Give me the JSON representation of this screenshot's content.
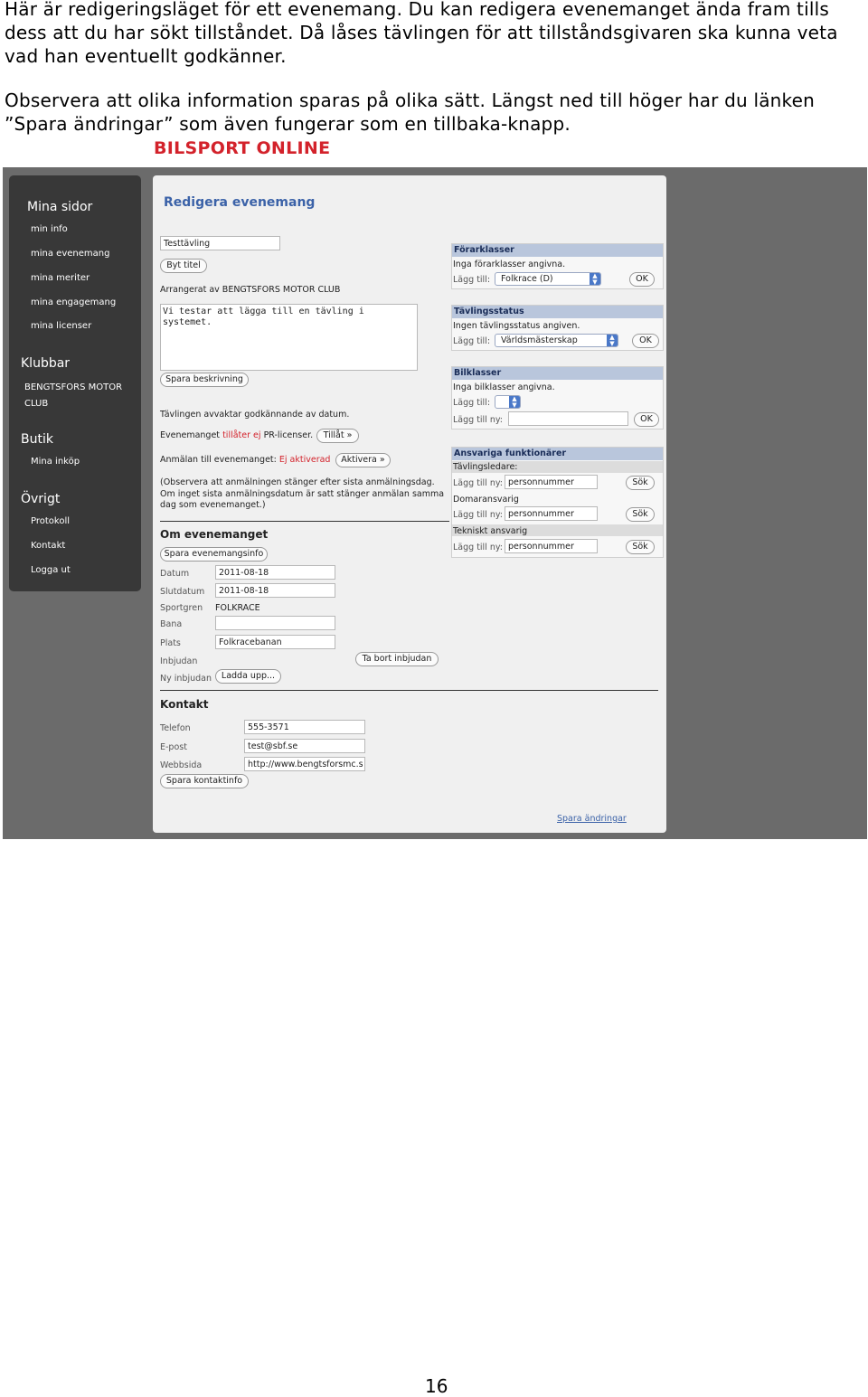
{
  "intro": {
    "p1": "Här är redigeringsläget för ett evenemang. Du kan redigera evenemanget ända fram tills dess att du har sökt tillståndet. Då låses tävlingen för att tillståndsgivaren ska kunna veta vad han eventuellt godkänner.",
    "p2": "Observera att olika information sparas på olika sätt. Längst ned till höger har du länken ”Spara ändringar” som även fungerar som en tillbaka-knapp."
  },
  "logo": "BILSPORT ONLINE",
  "sidebar": {
    "mina_sidor": "Mina sidor",
    "mina_items": [
      "min info",
      "mina evenemang",
      "mina meriter",
      "mina engagemang",
      "mina licenser"
    ],
    "klubbar": "Klubbar",
    "club": "BENGTSFORS MOTOR CLUB",
    "butik": "Butik",
    "butik_items": [
      "Mina inköp"
    ],
    "ovrigt": "Övrigt",
    "ovrigt_items": [
      "Protokoll",
      "Kontakt",
      "Logga ut"
    ]
  },
  "main": {
    "title": "Redigera evenemang",
    "event_name": "Testtävling",
    "byt_titel": "Byt titel",
    "arranger": "Arrangerat av BENGTSFORS MOTOR CLUB",
    "description": "Vi testar att lägga till en tävling i systemet.",
    "spara_beskrivning": "Spara beskrivning",
    "awaiting": "Tävlingen avvaktar godkännande av datum.",
    "event_prefix": "Evenemanget",
    "event_status": "tillåter ej",
    "event_suffix": "PR-licenser.",
    "tillat": "Tillåt »",
    "anmalan_prefix": "Anmälan till evenemanget:",
    "anmalan_status": "Ej aktiverad",
    "aktivera": "Aktivera »",
    "note": "(Observera att anmälningen stänger efter sista anmälningsdag. Om inget sista anmälningsdatum är satt stänger anmälan samma dag som evenemanget.)"
  },
  "om": {
    "title": "Om evenemanget",
    "save": "Spara evenemangsinfo",
    "datum_label": "Datum",
    "datum": "2011-08-18",
    "slutdatum_label": "Slutdatum",
    "slutdatum": "2011-08-18",
    "sportgren_label": "Sportgren",
    "sportgren": "FOLKRACE",
    "bana_label": "Bana",
    "bana": "",
    "plats_label": "Plats",
    "plats": "Folkracebanan",
    "inbjudan_label": "Inbjudan",
    "ta_bort": "Ta bort inbjudan",
    "ny_inbjudan_label": "Ny inbjudan",
    "ladda": "Ladda upp..."
  },
  "kontakt": {
    "title": "Kontakt",
    "telefon_label": "Telefon",
    "telefon": "555-3571",
    "epost_label": "E-post",
    "epost": "test@sbf.se",
    "webb_label": "Webbsida",
    "webb": "http://www.bengtsforsmc.s",
    "save": "Spara kontaktinfo"
  },
  "forarklasser": {
    "title": "Förarklasser",
    "status": "Inga förarklasser angivna.",
    "add_label": "Lägg till:",
    "selected": "Folkrace (D)",
    "ok": "OK"
  },
  "tavlingsstatus": {
    "title": "Tävlingsstatus",
    "status": "Ingen tävlingsstatus angiven.",
    "add_label": "Lägg till:",
    "selected": "Världsmästerskap",
    "ok": "OK"
  },
  "bilklasser": {
    "title": "Bilklasser",
    "status": "Inga bilklasser angivna.",
    "add_label": "Lägg till:",
    "selected": "",
    "new_label": "Lägg till ny:",
    "ok": "OK"
  },
  "ansvariga": {
    "title": "Ansvariga funktionärer",
    "roles": [
      {
        "name": "Tävlingsledare:",
        "add_label": "Lägg till ny:",
        "placeholder": "personnummer",
        "button": "Sök"
      },
      {
        "name": "Domaransvarig",
        "add_label": "Lägg till ny:",
        "placeholder": "personnummer",
        "button": "Sök"
      },
      {
        "name": "Tekniskt ansvarig",
        "add_label": "Lägg till ny:",
        "placeholder": "personnummer",
        "button": "Sök"
      }
    ]
  },
  "footer_link": "Spara ändringar",
  "page_number": "16"
}
